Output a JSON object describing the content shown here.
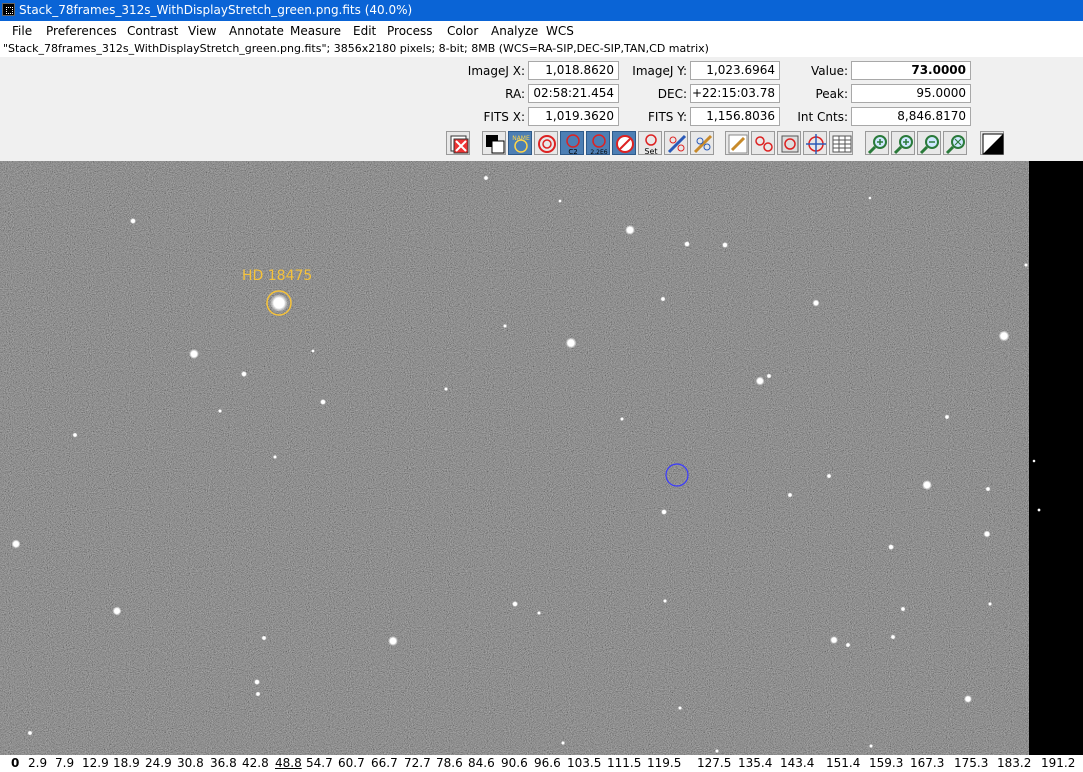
{
  "window": {
    "title": "Stack_78frames_312s_WithDisplayStretch_green.png.fits (40.0%)"
  },
  "menu": [
    "File",
    "Preferences",
    "Contrast",
    "View",
    "Annotate",
    "Measure",
    "Edit",
    "Process",
    "Color",
    "Analyze",
    "WCS"
  ],
  "info": "\"Stack_78frames_312s_WithDisplayStretch_green.png.fits\"; 3856x2180 pixels; 8-bit; 8MB (WCS=RA-SIP,DEC-SIP,TAN,CD matrix)",
  "coords": {
    "imagej_x": {
      "label": "ImageJ X:",
      "value": "1,018.8620"
    },
    "imagej_y": {
      "label": "ImageJ Y:",
      "value": "1,023.6964"
    },
    "value": {
      "label": "Value:",
      "value": "73.0000"
    },
    "ra": {
      "label": "RA:",
      "value": "02:58:21.454"
    },
    "dec": {
      "label": "DEC:",
      "value": "+22:15:03.78"
    },
    "peak": {
      "label": "Peak:",
      "value": "95.0000"
    },
    "fits_x": {
      "label": "FITS X:",
      "value": "1,019.3620"
    },
    "fits_y": {
      "label": "FITS Y:",
      "value": "1,156.8036"
    },
    "int_cnts": {
      "label": "Int Cnts:",
      "value": "8,846.8170"
    }
  },
  "toolbar": {
    "buttons": [
      {
        "icon": "clear-overlay-icon"
      },
      {
        "icon": "invert-icon"
      },
      {
        "icon": "name-icon",
        "text": "NAME"
      },
      {
        "icon": "aperture-ring-icon"
      },
      {
        "icon": "centroid-icon",
        "text": "C2"
      },
      {
        "icon": "radius-icon",
        "text": "2.2E6"
      },
      {
        "icon": "aperture-remove-icon"
      },
      {
        "icon": "set-aperture-icon",
        "text": "Set"
      },
      {
        "icon": "astrometry-icon"
      },
      {
        "icon": "measure-icon"
      },
      {
        "icon": "edit-icon"
      },
      {
        "icon": "multi-aperture-icon"
      },
      {
        "icon": "compare-icon"
      },
      {
        "icon": "target-icon"
      },
      {
        "icon": "table-icon"
      },
      {
        "icon": "zoom-in-icon"
      },
      {
        "icon": "zoom-in-icon"
      },
      {
        "icon": "zoom-out-icon"
      },
      {
        "icon": "zoom-fit-icon"
      },
      {
        "icon": "contrast-icon"
      }
    ]
  },
  "image": {
    "star_label": "HD 18475",
    "label_color": "#f5c23a",
    "aperture_color": "#3a3aff"
  },
  "axis_ticks": [
    "0",
    "2.9",
    "7.9",
    "12.9",
    "18.9",
    "24.9",
    "30.8",
    "36.8",
    "42.8",
    "48.8",
    "54.7",
    "60.7",
    "66.7",
    "72.7",
    "78.6",
    "84.6",
    "90.6",
    "96.6",
    "103.5",
    "111.5",
    "119.5",
    "127.5",
    "135.4",
    "143.4",
    "151.4",
    "159.3",
    "167.3",
    "175.3",
    "183.2",
    "191.2"
  ]
}
